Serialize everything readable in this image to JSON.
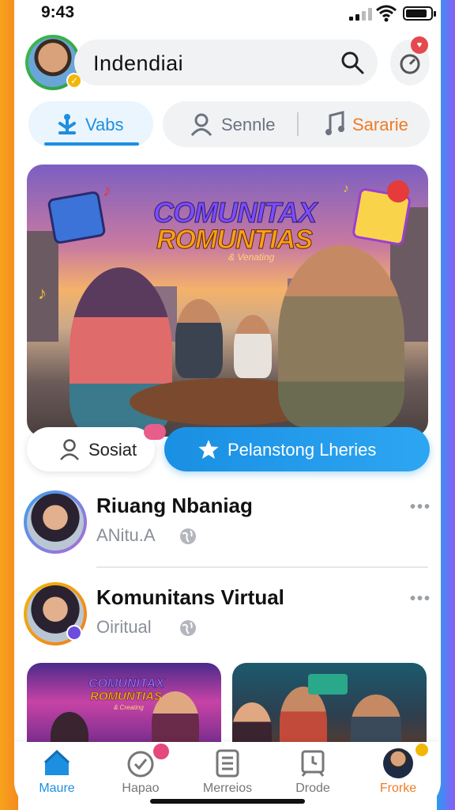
{
  "status": {
    "time": "9:43"
  },
  "header": {
    "title": "Indendiai"
  },
  "tabs": {
    "active": "Vabs",
    "second": "Sennle",
    "third": "Sararie"
  },
  "hero": {
    "logo_line1": "COMUNITAX",
    "logo_line2": "ROMUNTIAS",
    "logo_sub": "& Venating"
  },
  "actions": {
    "social": "Sosiat",
    "premium": "Pelanstong Lheries"
  },
  "list": [
    {
      "name": "Riuang Nbaniag",
      "sub": "ANitu.A"
    },
    {
      "name": "Komunitans Virtual",
      "sub": "Oiritual"
    }
  ],
  "thumbs": {
    "t1_line1": "COMUNITAX",
    "t1_line2": "ROMUNTIAS",
    "t1_line3": "& Creating"
  },
  "nav": [
    {
      "label": "Maure"
    },
    {
      "label": "Hapao"
    },
    {
      "label": "Merreios"
    },
    {
      "label": "Drode"
    },
    {
      "label": "Frorke"
    }
  ],
  "colors": {
    "accent": "#1d8fe0",
    "orange": "#f07b24",
    "badge_red": "#e5484d"
  }
}
